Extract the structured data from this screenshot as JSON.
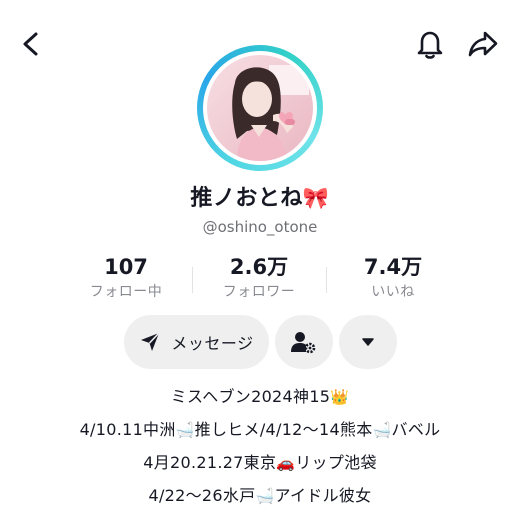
{
  "profile": {
    "username": "推ノおとね",
    "username_emoji": "🎀",
    "handle": "@oshino_otone"
  },
  "stats": [
    {
      "value": "107",
      "label": "フォロー中"
    },
    {
      "value": "2.6万",
      "label": "フォロワー"
    },
    {
      "value": "7.4万",
      "label": "いいね"
    }
  ],
  "actions": {
    "message_label": "メッセージ"
  },
  "bio": [
    {
      "a": "ミスヘブン2024神15",
      "e1": "👑"
    },
    {
      "a": "4/10.11中洲",
      "e1": "🛁",
      "b": "推しヒメ/4/12〜14熊本",
      "e2": "🛁",
      "c": "バベル"
    },
    {
      "a": "4月20.21.27東京",
      "e1": "🚗",
      "b": "リップ池袋"
    },
    {
      "a": "4/22〜26水戸",
      "e1": "🛁",
      "b": "アイドル彼女"
    }
  ],
  "icons": {
    "back": "chevron-left-icon",
    "bell": "bell-icon",
    "share": "share-arrow-icon",
    "message": "send-plane-icon",
    "follow": "user-settings-icon",
    "more": "triangle-down-icon"
  },
  "colors": {
    "text": "#161823",
    "secondary": "#8a8b91",
    "button_bg": "#efefef",
    "avatar_ring": "#33c6e0"
  }
}
